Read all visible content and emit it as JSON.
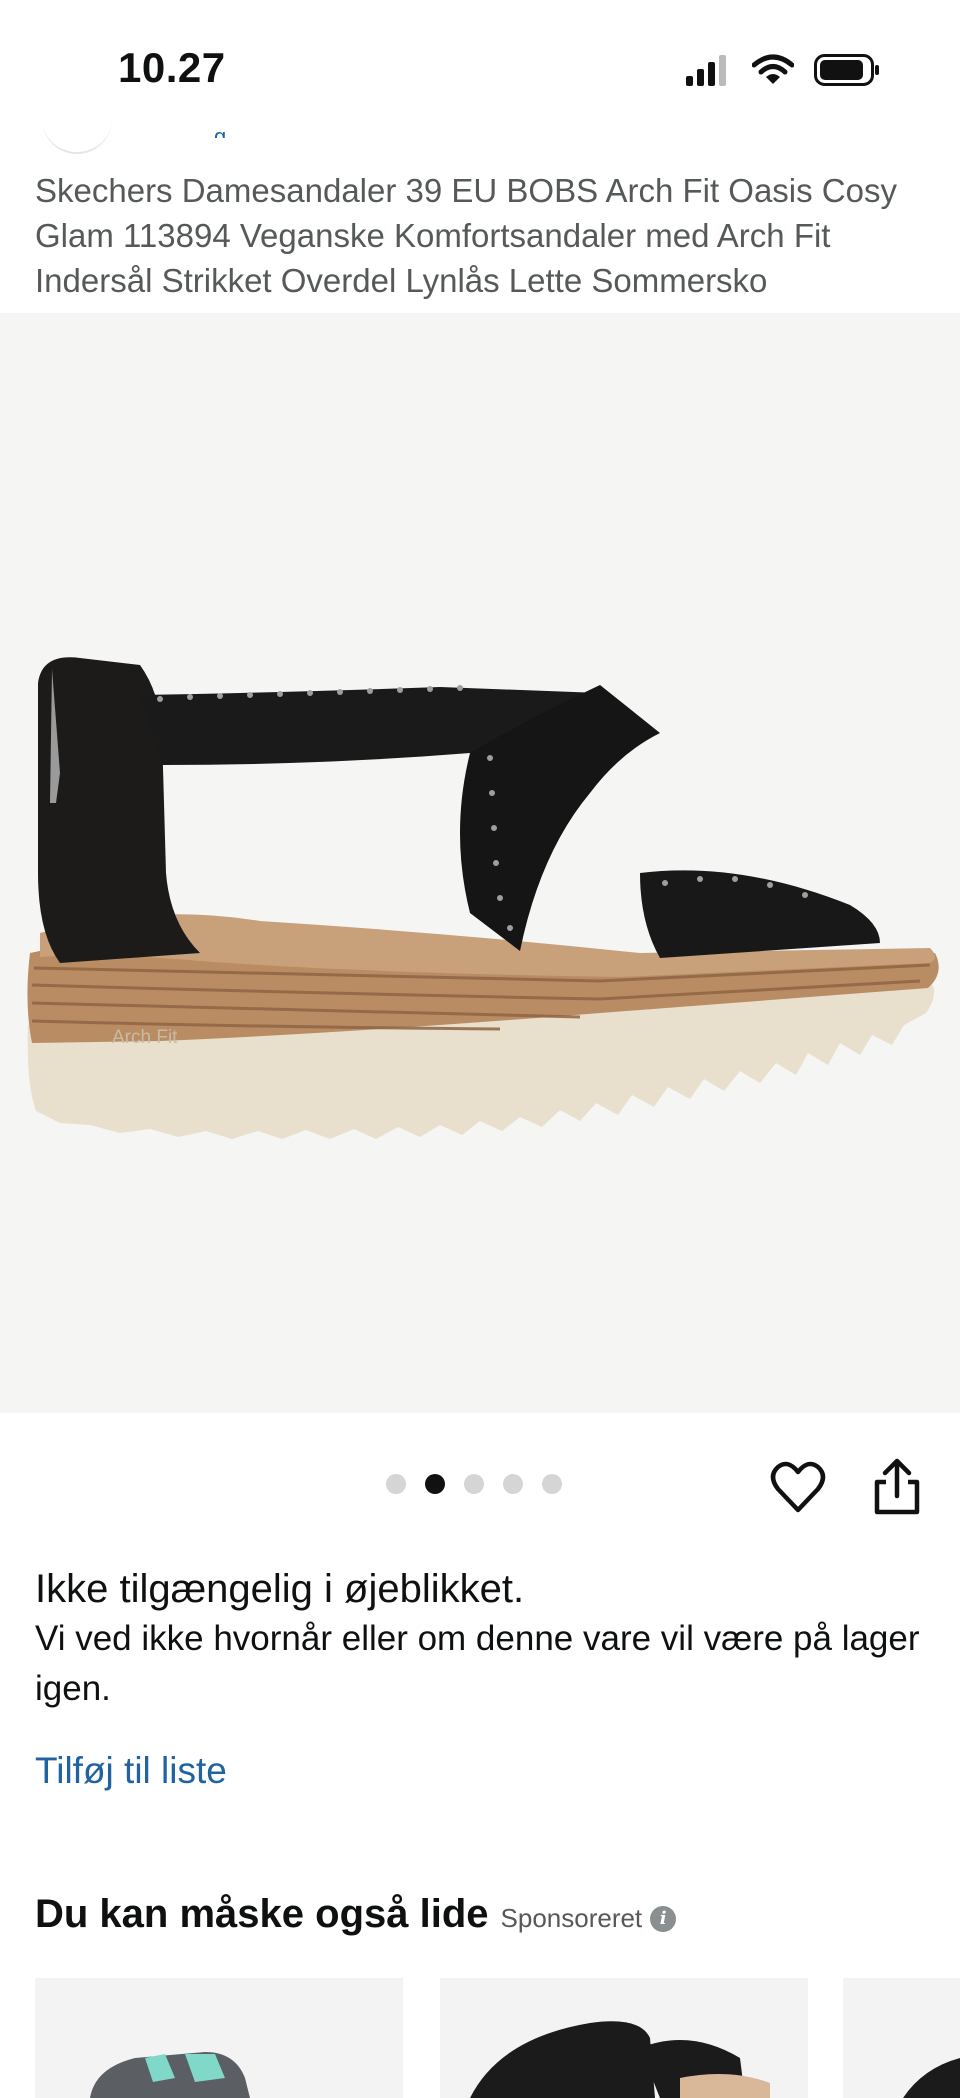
{
  "status_bar": {
    "time": "10.27"
  },
  "product": {
    "title": "Skechers Damesandaler 39 EU BOBS Arch Fit Oasis Cosy Glam 113894 Veganske Komfortsandaler med Arch Fit Indersål Strikket Overdel Lynlås Lette Sommersko",
    "image_sole_text": "Arch Fit"
  },
  "gallery": {
    "image_count": 5,
    "active_index": 1
  },
  "availability": {
    "title": "Ikke tilgængelig i øjeblikket.",
    "description": "Vi ved ikke hvornår eller om denne vare vil være på lager igen."
  },
  "actions": {
    "add_to_list": "Tilføj til liste"
  },
  "recommendations": {
    "title": "Du kan måske også lide",
    "sponsored": "Sponsoreret",
    "info_glyph": "i"
  },
  "colors": {
    "link": "#2162a1",
    "text": "#0f1111",
    "muted": "#565959",
    "gallery_bg": "#f5f5f4"
  },
  "icons": [
    "signal-icon",
    "wifi-icon",
    "battery-icon",
    "heart-icon",
    "share-icon",
    "info-icon"
  ]
}
